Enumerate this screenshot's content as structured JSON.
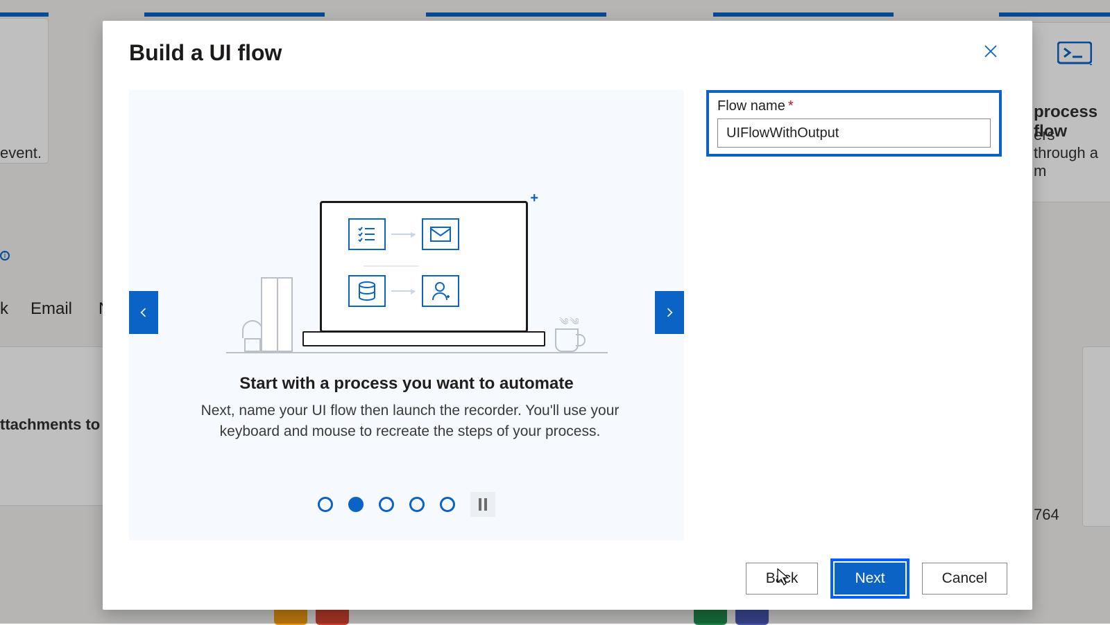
{
  "background": {
    "event_text": "event.",
    "task_label": "k",
    "email_label": "Email",
    "attachments_label": "ttachments to Or",
    "process_flow_label": "process flow",
    "process_flow_desc": "ers through a m",
    "stat": "764"
  },
  "dialog": {
    "title": "Build a UI flow",
    "carousel": {
      "heading": "Start with a process you want to automate",
      "body": "Next, name your UI flow then launch the recorder. You'll use your keyboard and mouse to recreate the steps of your process.",
      "page_count": 5,
      "active_index": 1
    },
    "form": {
      "flow_name_label": "Flow name",
      "flow_name_value": "UIFlowWithOutput"
    },
    "footer": {
      "back": "Back",
      "next": "Next",
      "cancel": "Cancel"
    }
  }
}
